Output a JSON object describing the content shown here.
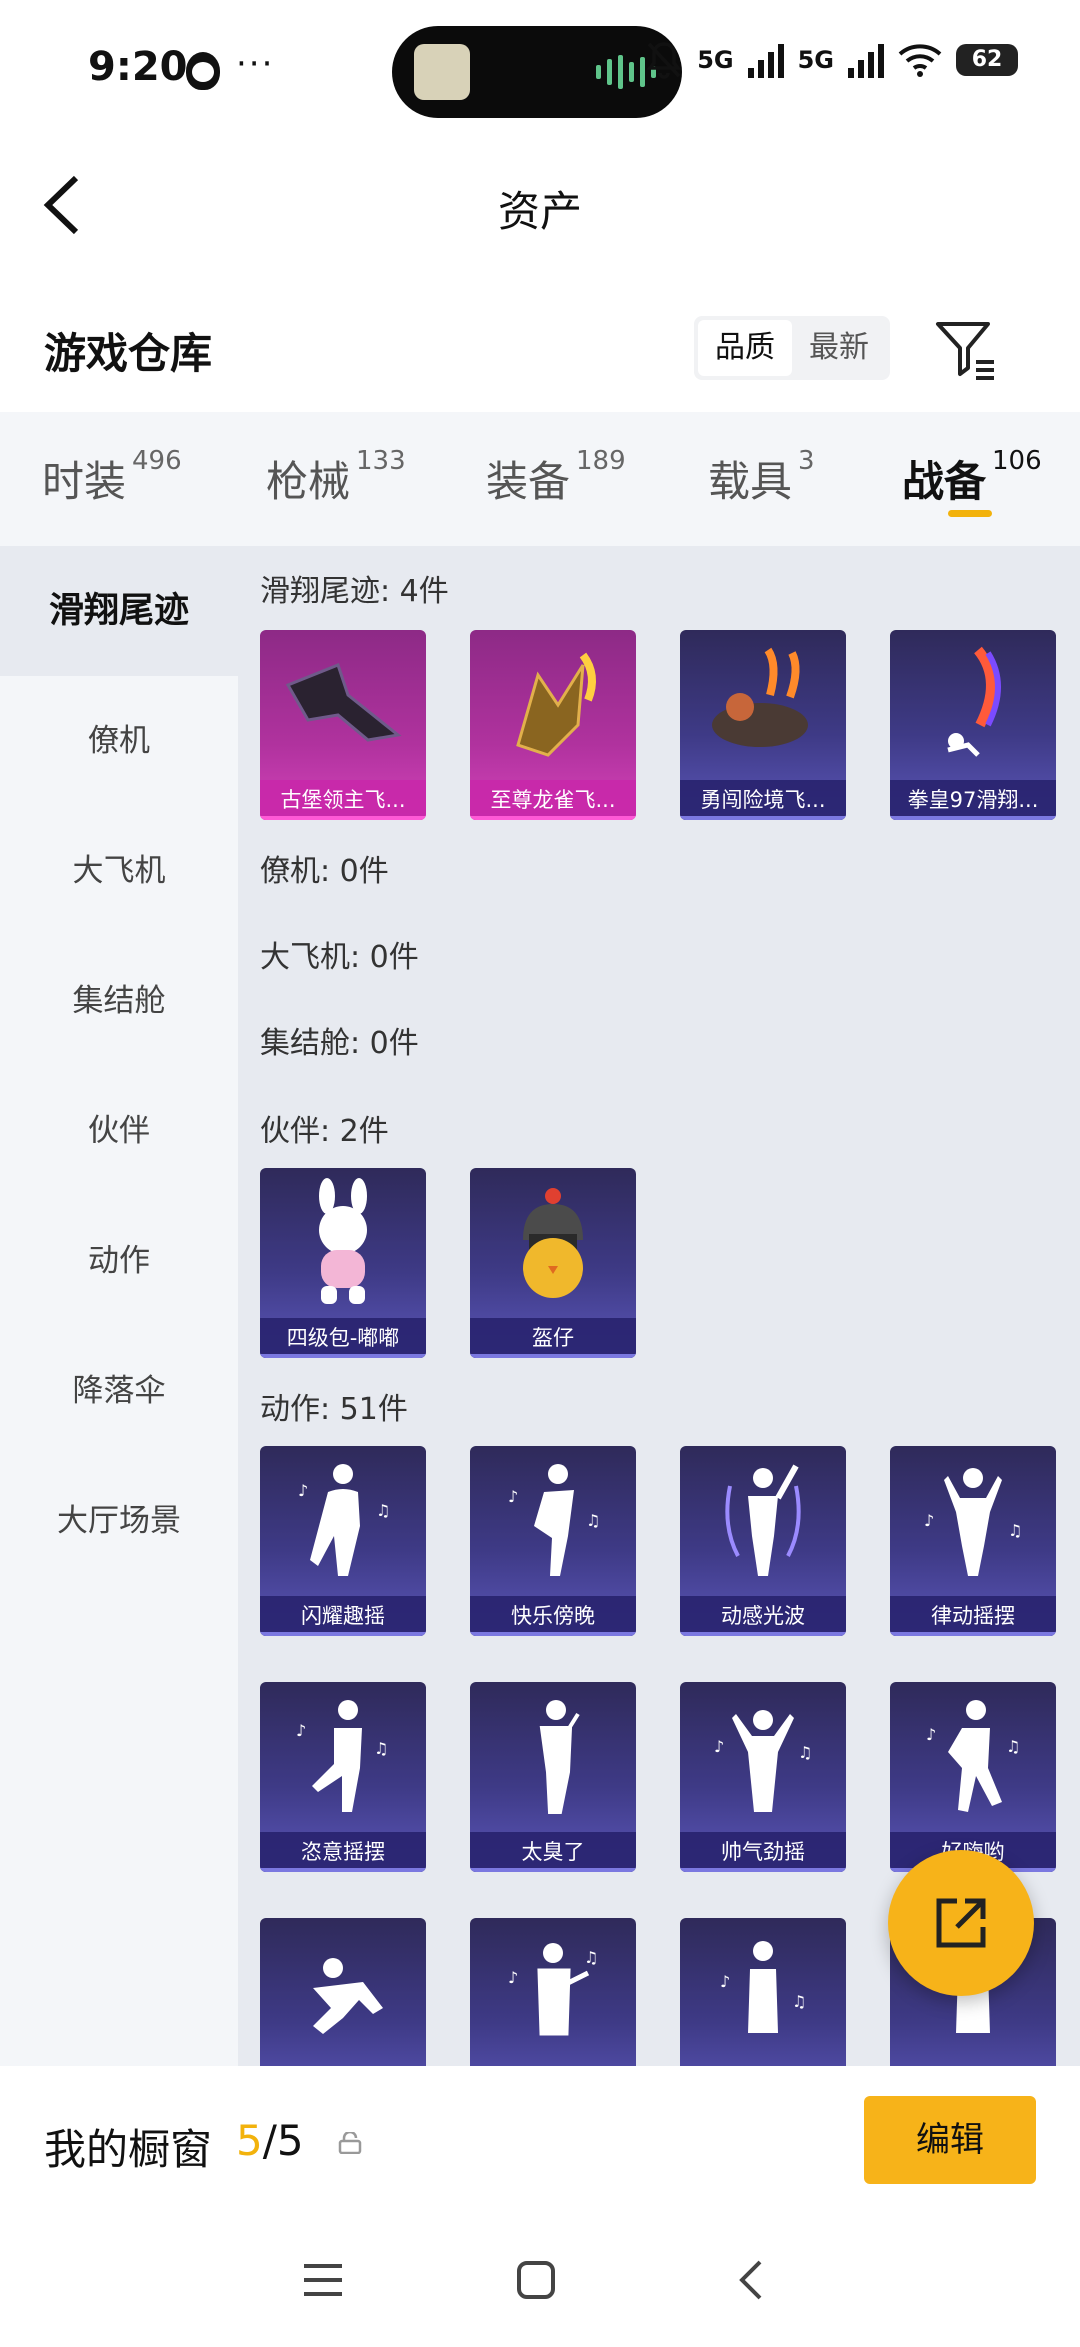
{
  "status": {
    "time": "9:20",
    "dots": "···",
    "net1": "5G",
    "net2": "5G",
    "battery": "62"
  },
  "header": {
    "title": "资产"
  },
  "repo": {
    "title": "游戏仓库",
    "sort_quality": "品质",
    "sort_latest": "最新"
  },
  "tabs": [
    {
      "label": "时装",
      "count": "496"
    },
    {
      "label": "枪械",
      "count": "133"
    },
    {
      "label": "装备",
      "count": "189"
    },
    {
      "label": "载具",
      "count": "3"
    },
    {
      "label": "战备",
      "count": "106"
    }
  ],
  "sidebar": [
    "滑翔尾迹",
    "僚机",
    "大飞机",
    "集结舱",
    "伙伴",
    "动作",
    "降落伞",
    "大厅场景"
  ],
  "sections": {
    "glide": "滑翔尾迹: 4件",
    "wingman": "僚机: 0件",
    "plane": "大飞机: 0件",
    "pod": "集结舱: 0件",
    "partner": "伙伴: 2件",
    "action": "动作: 51件"
  },
  "glide_items": [
    "古堡领主飞...",
    "至尊龙雀飞...",
    "勇闯险境飞...",
    "拳皇97滑翔..."
  ],
  "partner_items": [
    "四级包-嘟嘟",
    "盔仔"
  ],
  "action_items": [
    "闪耀趣摇",
    "快乐傍晚",
    "动感光波",
    "律动摇摆",
    "恣意摇摆",
    "太臭了",
    "帅气劲摇",
    "好嗨哟"
  ],
  "bottom": {
    "label": "我的橱窗",
    "count_current": "5",
    "count_total": "/5",
    "edit": "编辑"
  }
}
